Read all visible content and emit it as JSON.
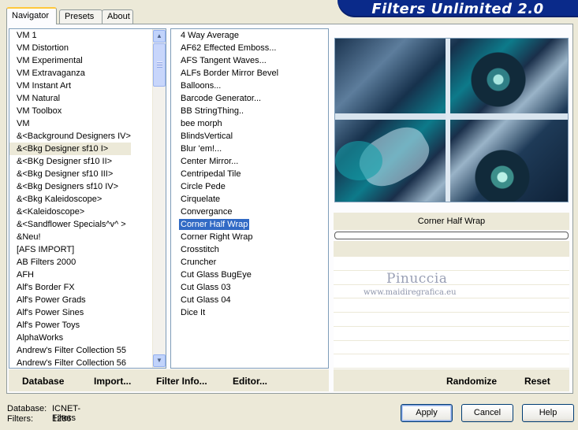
{
  "app": {
    "title": "Filters Unlimited 2.0"
  },
  "tabs": [
    {
      "label": "Navigator",
      "active": true
    },
    {
      "label": "Presets",
      "active": false
    },
    {
      "label": "About",
      "active": false
    }
  ],
  "categories": [
    "VM 1",
    "VM Distortion",
    "VM Experimental",
    "VM Extravaganza",
    "VM Instant Art",
    "VM Natural",
    "VM Toolbox",
    "VM",
    "&<Background Designers IV>",
    "&<Bkg Designer sf10 I>",
    "&<BKg Designer sf10 II>",
    "&<Bkg Designer sf10 III>",
    "&<Bkg Designers sf10 IV>",
    "&<Bkg Kaleidoscope>",
    "&<Kaleidoscope>",
    "&<Sandflower Specials^v^ >",
    "&Neu!",
    "[AFS IMPORT]",
    "AB Filters 2000",
    "AFH",
    "Alf's Border FX",
    "Alf's Power Grads",
    "Alf's Power Sines",
    "Alf's Power Toys",
    "AlphaWorks",
    "Andrew's Filter Collection 55",
    "Andrew's Filter Collection 56"
  ],
  "categories_highlighted_index": 9,
  "filters": [
    "4 Way Average",
    "AF62 Effected Emboss...",
    "AFS Tangent Waves...",
    "ALFs Border Mirror Bevel",
    "Balloons...",
    "Barcode Generator...",
    "BB StringThing..",
    "bee morph",
    "BlindsVertical",
    "Blur 'em!...",
    "Center Mirror...",
    "Centripedal Tile",
    "Circle Pede",
    "Cirquelate",
    "Convergance",
    "Corner Half Wrap",
    "Corner Right Wrap",
    "Crosstitch",
    "Cruncher",
    "Cut Glass  BugEye",
    "Cut Glass 03",
    "Cut Glass 04",
    "Dice It"
  ],
  "filters_selected_index": 15,
  "selected_filter_name": "Corner Half Wrap",
  "watermark": {
    "name": "Pinuccia",
    "url": "www.maidiregrafica.eu"
  },
  "toolbar": {
    "database": "Database",
    "import": "Import...",
    "filter_info": "Filter Info...",
    "editor": "Editor...",
    "randomize": "Randomize",
    "reset": "Reset"
  },
  "status": {
    "database_label": "Database:",
    "database_value": "ICNET-Filters",
    "filters_label": "Filters:",
    "filters_value": "1286"
  },
  "buttons": {
    "apply": "Apply",
    "cancel": "Cancel",
    "help": "Help"
  },
  "colors": {
    "banner": "#0a2a8a",
    "selection": "#316ac5",
    "face": "#ece9d8"
  }
}
